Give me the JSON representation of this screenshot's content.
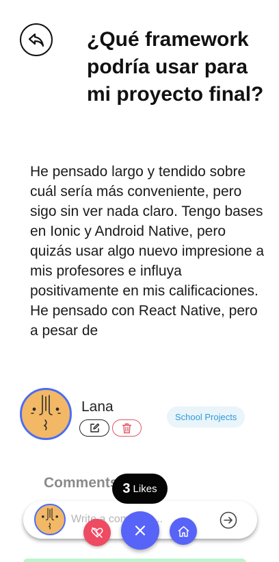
{
  "post": {
    "title": "¿Qué framework podría usar para mi proyecto final?",
    "body": "He pensado largo y tendido sobre cuál sería más conveniente, pero sigo sin ver nada claro. Tengo bases en Ionic y Android Native, pero quizás usar algo nuevo impresione a mis profesores e influya positivamente en mis calificaciones. He pensado con React Native, pero a pesar de"
  },
  "author": {
    "name": "Lana",
    "tag": "School Projects"
  },
  "comments": {
    "heading": "Comments",
    "input_placeholder": "Write a comment..."
  },
  "likes": {
    "count": "3",
    "label": "Likes"
  },
  "icons": {
    "back": "back-arrow-icon",
    "edit": "edit-icon",
    "delete": "trash-icon",
    "send": "send-arrow-icon",
    "close": "close-icon",
    "unlike": "broken-heart-icon",
    "home": "home-icon"
  },
  "colors": {
    "accent": "#5863f8",
    "like": "#ee4a62",
    "avatar_bg": "#f2b866",
    "tag_text": "#2d9bd6",
    "tag_bg": "#eaf4fb",
    "likes_pill": "#050505"
  }
}
